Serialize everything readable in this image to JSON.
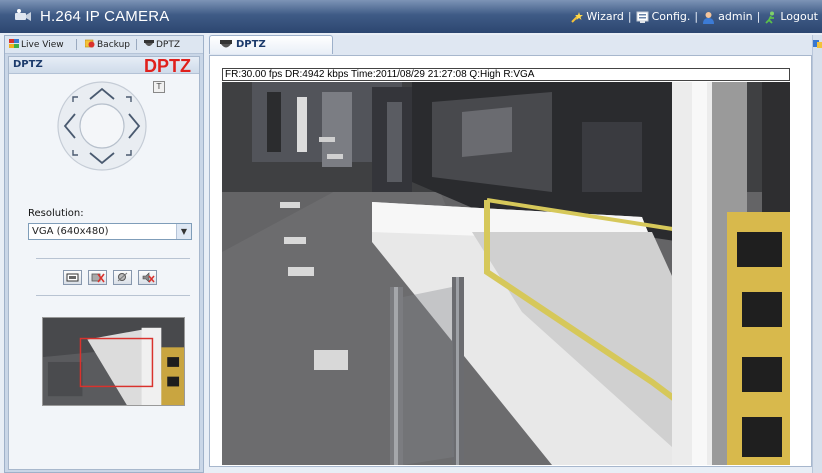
{
  "app": {
    "title": "H.264 IP CAMERA"
  },
  "topmenu": {
    "wizard": "Wizard",
    "config": "Config.",
    "user": "admin",
    "logout": "Logout",
    "separator": "|"
  },
  "lefttabs": {
    "live_view": "Live View",
    "backup": "Backup",
    "dptz": "DPTZ"
  },
  "dptz_panel": {
    "header_label": "DPTZ",
    "header_big": "DPTZ",
    "t_button": "T",
    "resolution_label": "Resolution:",
    "resolution_value": "VGA (640x480)",
    "tool_icons": [
      "snapshot-icon",
      "stop-record-icon",
      "zoom-icon",
      "mute-icon"
    ]
  },
  "content_tab": {
    "label": "DPTZ"
  },
  "video": {
    "overlay_text": "FR:30.00 fps  DR:4942 kbps Time:2011/08/29 21:27:08 Q:High R:VGA"
  },
  "colors": {
    "titlebar": "#2c4670",
    "dptz_red": "#e0201c",
    "panel_bg": "#c9d6e7",
    "header_text": "#1b3a6b"
  }
}
